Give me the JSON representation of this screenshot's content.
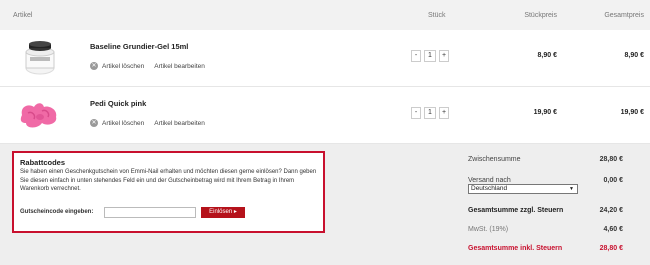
{
  "table_header": {
    "artikel": "Artikel",
    "stueck": "Stück",
    "stueckpreis": "Stückpreis",
    "gesamtpreis": "Gesamtpreis"
  },
  "items": [
    {
      "name": "Baseline Grundier-Gel 15ml",
      "delete_label": "Artikel löschen",
      "edit_label": "Artikel bearbeiten",
      "minus": "-",
      "qty": "1",
      "plus": "+",
      "unit_price": "8,90 €",
      "total_price": "8,90 €"
    },
    {
      "name": "Pedi Quick pink",
      "delete_label": "Artikel löschen",
      "edit_label": "Artikel bearbeiten",
      "minus": "-",
      "qty": "1",
      "plus": "+",
      "unit_price": "19,90 €",
      "total_price": "19,90 €"
    }
  ],
  "coupon": {
    "title": "Rabattcodes",
    "text": "Sie haben einen Geschenkgutschein von Emmi-Nail erhalten und möchten diesen gerne einlösen? Dann geben Sie diesen einfach in unten stehendes Feld ein und der Gutscheinbetrag wird mit Ihrem Betrag in Ihrem Warenkorb verrechnet.",
    "input_label": "Gutscheincode eingeben:",
    "input_value": "",
    "button_label": "Einlösen ▸"
  },
  "summary": {
    "zwischensumme_label": "Zwischensumme",
    "zwischensumme_value": "28,80 €",
    "versand_label": "Versand nach",
    "versand_value": "0,00 €",
    "country": "Deutschland",
    "gesamt_ohne_label": "Gesamtsumme zzgl. Steuern",
    "gesamt_ohne_value": "24,20 €",
    "mwst_label": "MwSt. (19%)",
    "mwst_value": "4,60 €",
    "gesamt_inkl_label": "Gesamtsumme inkl. Steuern",
    "gesamt_inkl_value": "28,80 €"
  },
  "colors": {
    "accent": "#c8102e",
    "button": "#b5121b",
    "background_panel": "#eeeeee"
  }
}
